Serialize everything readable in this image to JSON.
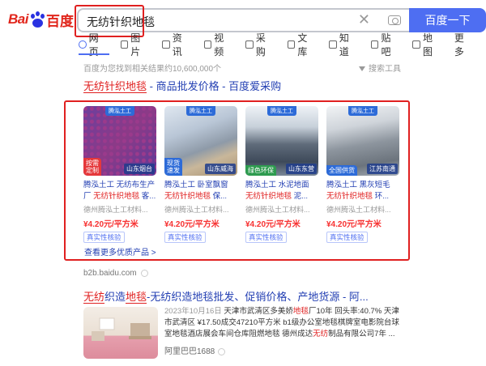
{
  "logo": {
    "part1": "Bai",
    "part2": "百度"
  },
  "search": {
    "query": "无纺针织地毯",
    "clear_icon": "✕",
    "camera_icon": "camera-icon"
  },
  "search_button": "百度一下",
  "tabs": [
    {
      "label": "网页",
      "icon": "web-icon"
    },
    {
      "label": "图片",
      "icon": "image-icon"
    },
    {
      "label": "资讯",
      "icon": "news-icon"
    },
    {
      "label": "视频",
      "icon": "video-icon"
    },
    {
      "label": "采购",
      "icon": "purchase-icon"
    },
    {
      "label": "文库",
      "icon": "library-icon"
    },
    {
      "label": "知道",
      "icon": "question-icon"
    },
    {
      "label": "贴吧",
      "icon": "tieba-icon"
    },
    {
      "label": "地图",
      "icon": "map-icon"
    },
    {
      "label": "更多",
      "icon": ""
    }
  ],
  "result_count": "百度为您找到相关结果约10,600,000个",
  "search_tools": "搜索工具",
  "result1": {
    "title_hl": "无纺针织地毯",
    "title_rest": " - 商品批发价格 - 百度爱采购"
  },
  "cards": [
    {
      "brand": "腾泓土工",
      "location": "山东烟台",
      "tag": "按需\n定制",
      "name_plain": "腾泓土工 无纺布生产厂 ",
      "name_hl": "无纺针织地毯",
      "name_tail": " 客...",
      "seller": "德州腾泓土工材料...",
      "price": "¥4.20元/平方米",
      "verify": "真实性核验"
    },
    {
      "brand": "腾泓土工",
      "location": "山东威海",
      "tag": "现货\n速发",
      "name_plain": "腾泓土工 卧室飘窗 ",
      "name_hl": "无纺针织地毯",
      "name_tail": " 保...",
      "seller": "德州腾泓土工材料...",
      "price": "¥4.20元/平方米",
      "verify": "真实性核验"
    },
    {
      "brand": "腾泓土工",
      "location": "山东东营",
      "tag": "绿色环保",
      "name_plain": "腾泓土工 水泥地面 ",
      "name_hl": "无纺针织地毯",
      "name_tail": " 泥...",
      "seller": "德州腾泓土工材料...",
      "price": "¥4.20元/平方米",
      "verify": "真实性核验"
    },
    {
      "brand": "腾泓土工",
      "location": "江苏南通",
      "tag": "全国供货",
      "name_plain": "腾泓土工 黑灰短毛 ",
      "name_hl": "无纺针织地毯",
      "name_tail": " 环...",
      "seller": "德州腾泓土工材料...",
      "price": "¥4.20元/平方米",
      "verify": "真实性核验"
    }
  ],
  "more_products": "查看更多优质产品 >",
  "result2": {
    "url": "b2b.baidu.com",
    "title_hl": "无纺",
    "title_mid": "织造",
    "title_hl2": "地毯",
    "title_rest": "-无纺织造地毯批发、促销价格、产地货源 - 阿...",
    "date": "2023年10月16日",
    "snippet_a": " 天津市武清区多美娇",
    "snippet_hl1": "地毯",
    "snippet_b": "厂10年 回头率:40.7% 天津市武清区 ¥17.50成交47210平方米 b1级办公室地毯棋牌室电影院台球室地毯酒店展会车间仓库阻燃地毯 德州成达",
    "snippet_hl2": "无纺",
    "snippet_c": "制品有限公司7年 ...",
    "source": "阿里巴巴1688"
  },
  "colors": {
    "accent": "#4e6ef2",
    "link": "#2440b3",
    "highlight": "#e02020",
    "price": "#f73131"
  }
}
